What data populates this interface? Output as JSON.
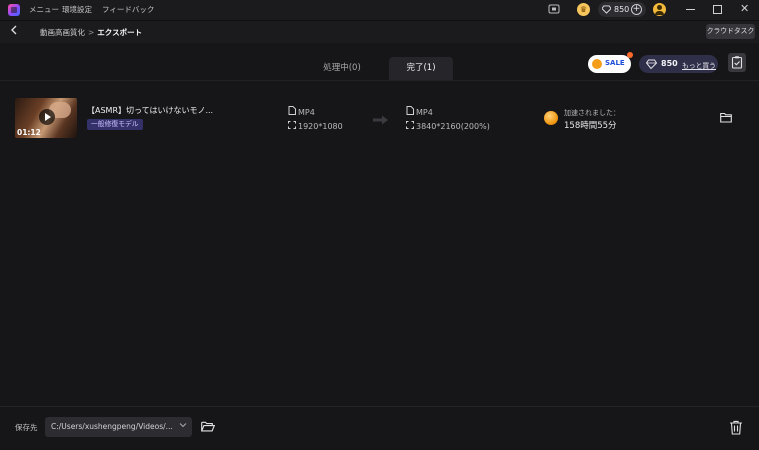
{
  "titlebar": {
    "menus": [
      "メニュー",
      "環境設定",
      "フィードバック"
    ],
    "gems": "850"
  },
  "nav": {
    "breadcrumb_parent": "動画高画質化",
    "breadcrumb_sep": ">",
    "breadcrumb_current": "エクスポート",
    "cloud_task": "クラウドタスク"
  },
  "tabs": [
    {
      "label": "処理中(0)"
    },
    {
      "label": "完了(1)"
    }
  ],
  "promo": {
    "sale": "SALE",
    "gems": "850",
    "buy_more": "もっと買う"
  },
  "row": {
    "title": "【ASMR】切ってはいけないモノ...",
    "duration": "01:12",
    "model": "一般修復モデル",
    "source_format": "MP4",
    "source_resolution": "1920*1080",
    "output_format": "MP4",
    "output_resolution": "3840*2160(200%)",
    "speed_label": "加速されました：",
    "time": "158時間55分"
  },
  "footer": {
    "save_label": "保存先",
    "path": "C:/Users/xushengpeng/Videos/..."
  }
}
